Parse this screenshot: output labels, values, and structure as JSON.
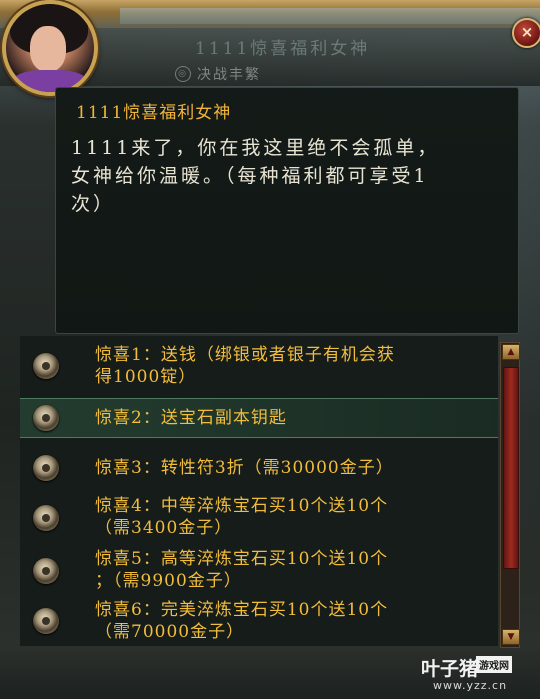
{
  "window": {
    "title": "1111惊喜福利女神",
    "subtitle": "决战丰繁"
  },
  "dialog": {
    "npc_name": "1111惊喜福利女神",
    "message": "1111来了，你在我这里绝不会孤单，\n女神给你温暖。（每种福利都可享受1\n次）"
  },
  "options": [
    {
      "label": "惊喜1：送钱（绑银或者银子有机会获\n得1000锭）",
      "selected": false
    },
    {
      "label": "惊喜2：送宝石副本钥匙",
      "selected": true
    },
    {
      "label": "惊喜3：转性符3折（需30000金子）",
      "selected": false
    },
    {
      "label": "惊喜4：中等淬炼宝石买10个送10个\n（需3400金子）",
      "selected": false
    },
    {
      "label": "惊喜5：高等淬炼宝石买10个送10个\n；（需9900金子）",
      "selected": false
    },
    {
      "label": "惊喜6：完美淬炼宝石买10个送10个\n（需70000金子）",
      "selected": false
    }
  ],
  "buttons": {
    "close_label": "×",
    "scroll_up": "▲",
    "scroll_down": "▼"
  },
  "watermark": {
    "brand": "叶子猪",
    "tag": "游戏网",
    "url": "www.yzz.cn"
  },
  "colors": {
    "option_text": "#f2bd3c",
    "npc_name": "#f0b53a",
    "message_text": "#e8e4d4",
    "selected_row": "#243e30"
  },
  "icons": {
    "option": "coin-icon",
    "close": "close-icon"
  }
}
